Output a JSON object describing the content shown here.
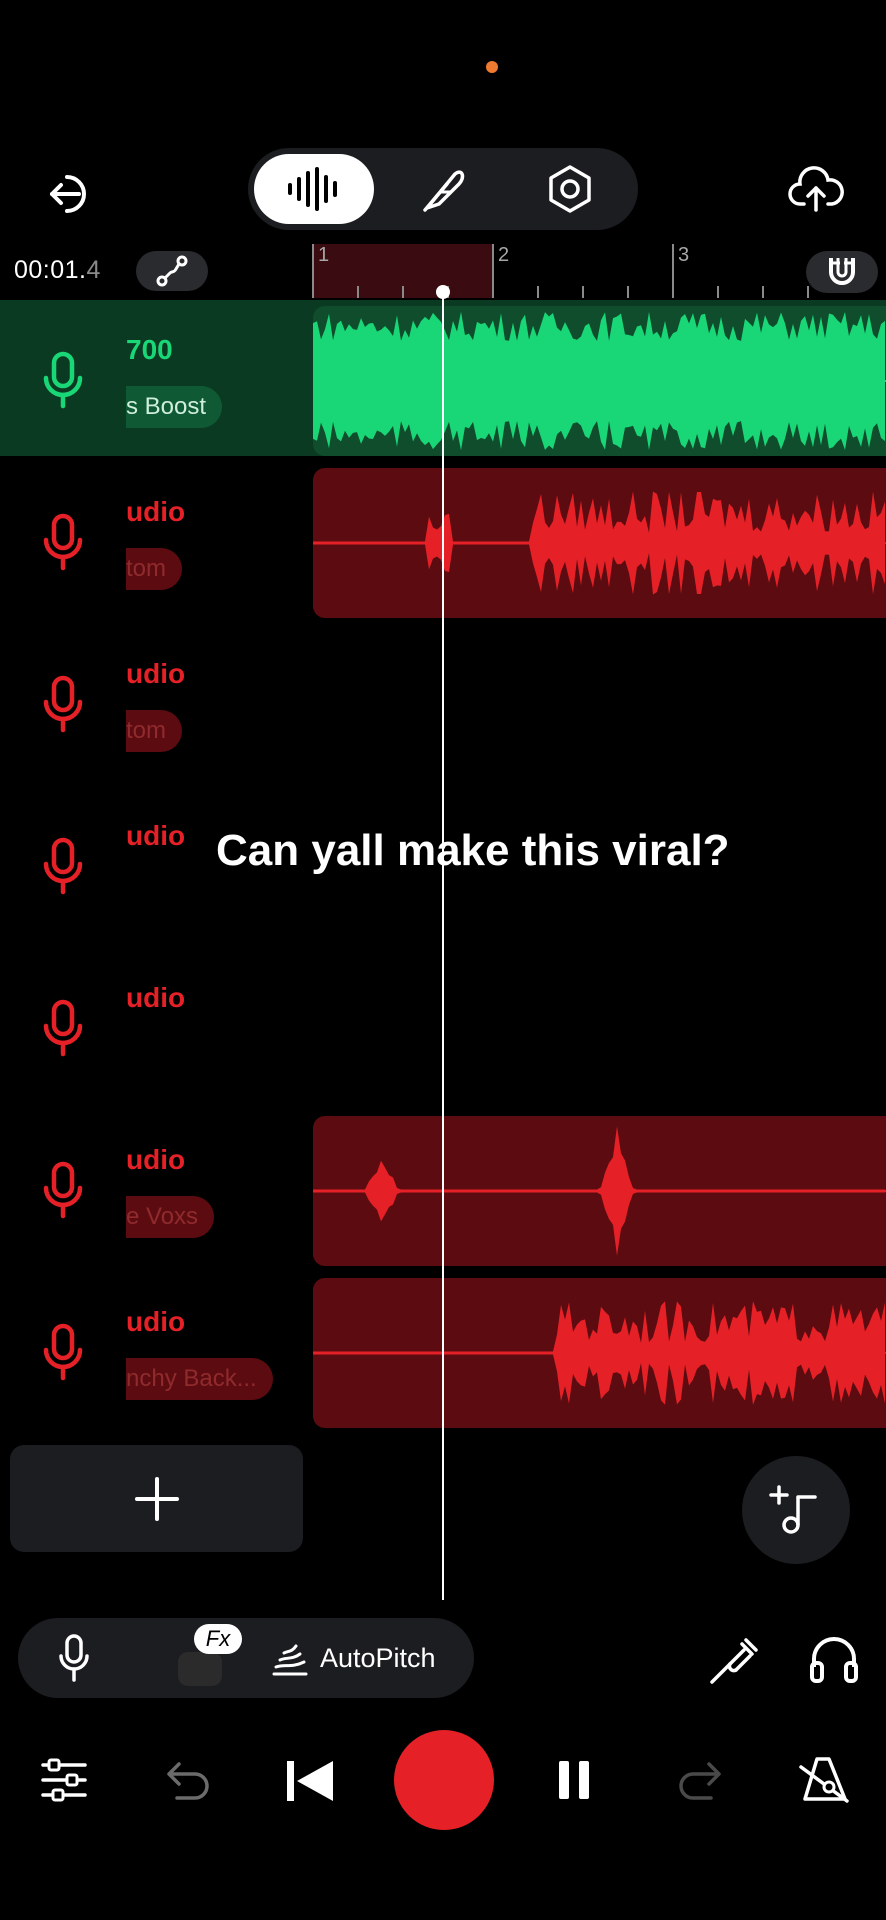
{
  "status": {
    "dot_color": "#f07a30"
  },
  "header": {
    "back_icon": "exit-icon",
    "modes": [
      {
        "name": "waveform",
        "icon": "waveform-icon",
        "active": true
      },
      {
        "name": "lyrics",
        "icon": "feather-icon",
        "active": false
      },
      {
        "name": "settings",
        "icon": "hex-nut-icon",
        "active": false
      }
    ],
    "upload_icon": "cloud-upload-icon"
  },
  "timeline": {
    "time_main": "00:01.",
    "time_fraction": "4",
    "bars": [
      "1",
      "2",
      "3"
    ]
  },
  "tracks": [
    {
      "name": "700",
      "preset": "s Boost",
      "color": "green",
      "clip": true
    },
    {
      "name": "udio",
      "preset": "tom",
      "color": "red",
      "clip": true
    },
    {
      "name": "udio",
      "preset": "tom",
      "color": "red",
      "clip": false
    },
    {
      "name": "udio",
      "preset": "",
      "color": "red",
      "clip": false
    },
    {
      "name": "udio",
      "preset": "",
      "color": "red",
      "clip": false
    },
    {
      "name": "udio",
      "preset": "e Voxs",
      "color": "red",
      "clip": true
    },
    {
      "name": "udio",
      "preset": "nchy Back...",
      "color": "red",
      "clip": true
    }
  ],
  "overlay": {
    "caption": "Can yall make this viral?"
  },
  "fx_bar": {
    "fx_badge": "Fx",
    "autopitch_label": "AutoPitch"
  },
  "colors": {
    "green": "#19d777",
    "red": "#e52127",
    "accent_dark_red": "#5c0c10"
  }
}
